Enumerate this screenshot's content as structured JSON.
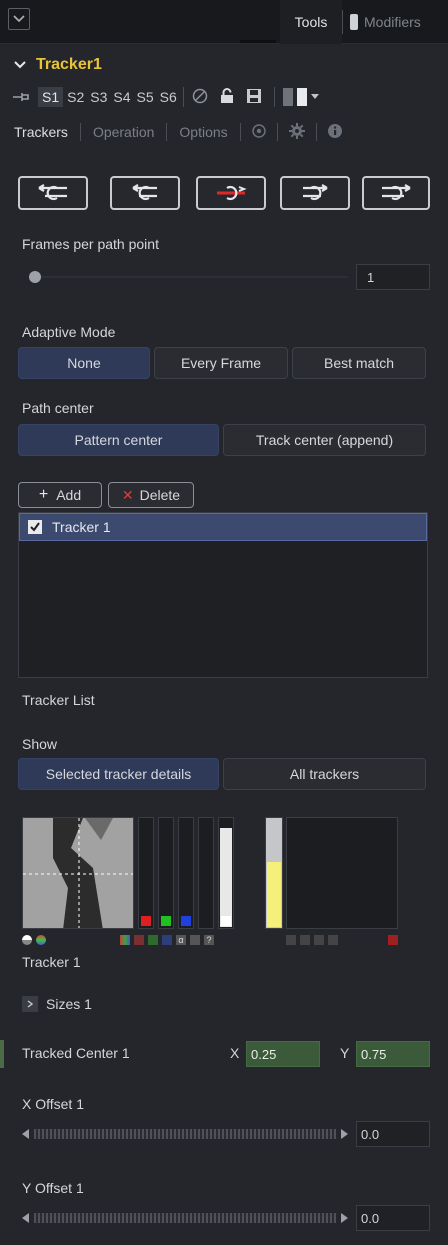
{
  "header": {
    "tools_tab": "Tools",
    "modifiers_tab": "Modifiers"
  },
  "tool": {
    "name": "Tracker1",
    "slots": [
      "S1",
      "S2",
      "S3",
      "S4",
      "S5",
      "S6"
    ]
  },
  "tabs": [
    "Trackers",
    "Operation",
    "Options"
  ],
  "frames_per_path_point": {
    "label": "Frames per path point",
    "value": "1"
  },
  "adaptive_mode": {
    "label": "Adaptive Mode",
    "options": [
      "None",
      "Every Frame",
      "Best match"
    ],
    "selected": "None"
  },
  "path_center": {
    "label": "Path center",
    "options": [
      "Pattern center",
      "Track center (append)"
    ],
    "selected": "Pattern center"
  },
  "tracker_list": {
    "add_label": "Add",
    "delete_label": "Delete",
    "items": [
      {
        "name": "Tracker 1",
        "checked": true
      }
    ],
    "caption": "Tracker List"
  },
  "show": {
    "label": "Show",
    "options": [
      "Selected tracker details",
      "All trackers"
    ],
    "selected": "Selected tracker details"
  },
  "tracker_preview": {
    "name": "Tracker 1",
    "channel_colors": [
      "#e02020",
      "#20c020",
      "#2040e0"
    ],
    "white_level": 0.92,
    "yellow_level": 0.6
  },
  "sizes": {
    "label": "Sizes 1"
  },
  "tracked_center": {
    "label": "Tracked Center 1",
    "x_label": "X",
    "x_value": "0.25",
    "y_label": "Y",
    "y_value": "0.75"
  },
  "x_offset": {
    "label": "X Offset 1",
    "value": "0.0"
  },
  "y_offset": {
    "label": "Y Offset 1",
    "value": "0.0"
  }
}
